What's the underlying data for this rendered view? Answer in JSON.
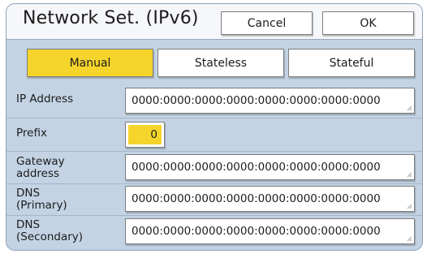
{
  "header": {
    "title": "Network Set. (IPv6)",
    "cancel_label": "Cancel",
    "ok_label": "OK"
  },
  "mode_tabs": {
    "manual": "Manual",
    "stateless": "Stateless",
    "stateful": "Stateful",
    "selected": "Manual"
  },
  "fields": {
    "ip_address": {
      "label": "IP Address",
      "value": "0000:0000:0000:0000:0000:0000:0000:0000"
    },
    "prefix": {
      "label": "Prefix",
      "value": "0"
    },
    "gateway": {
      "label_line1": "Gateway",
      "label_line2": "address",
      "value": "0000:0000:0000:0000:0000:0000:0000:0000"
    },
    "dns_primary": {
      "label_line1": "DNS",
      "label_line2": "(Primary)",
      "value": "0000:0000:0000:0000:0000:0000:0000:0000"
    },
    "dns_secondary": {
      "label_line1": "DNS",
      "label_line2": "(Secondary)",
      "value": "0000:0000:0000:0000:0000:0000:0000:0000"
    }
  },
  "colors": {
    "panel_bg": "#c3d3e4",
    "header_bg": "#f5f7fa",
    "accent_yellow": "#f5d42b"
  }
}
